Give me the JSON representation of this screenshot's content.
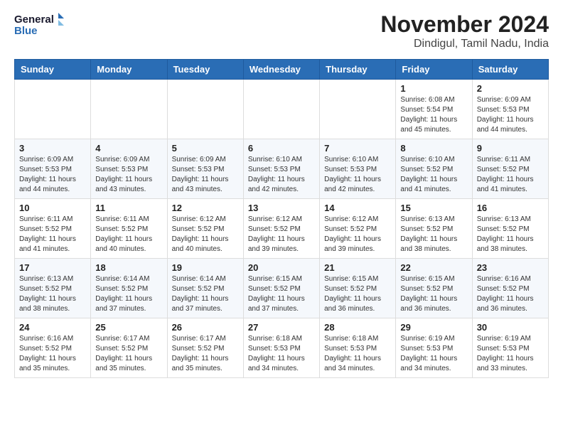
{
  "logo": {
    "line1": "General",
    "line2": "Blue"
  },
  "title": "November 2024",
  "subtitle": "Dindigul, Tamil Nadu, India",
  "weekdays": [
    "Sunday",
    "Monday",
    "Tuesday",
    "Wednesday",
    "Thursday",
    "Friday",
    "Saturday"
  ],
  "weeks": [
    [
      {
        "day": "",
        "sunrise": "",
        "sunset": "",
        "daylight": ""
      },
      {
        "day": "",
        "sunrise": "",
        "sunset": "",
        "daylight": ""
      },
      {
        "day": "",
        "sunrise": "",
        "sunset": "",
        "daylight": ""
      },
      {
        "day": "",
        "sunrise": "",
        "sunset": "",
        "daylight": ""
      },
      {
        "day": "",
        "sunrise": "",
        "sunset": "",
        "daylight": ""
      },
      {
        "day": "1",
        "sunrise": "Sunrise: 6:08 AM",
        "sunset": "Sunset: 5:54 PM",
        "daylight": "Daylight: 11 hours and 45 minutes."
      },
      {
        "day": "2",
        "sunrise": "Sunrise: 6:09 AM",
        "sunset": "Sunset: 5:53 PM",
        "daylight": "Daylight: 11 hours and 44 minutes."
      }
    ],
    [
      {
        "day": "3",
        "sunrise": "Sunrise: 6:09 AM",
        "sunset": "Sunset: 5:53 PM",
        "daylight": "Daylight: 11 hours and 44 minutes."
      },
      {
        "day": "4",
        "sunrise": "Sunrise: 6:09 AM",
        "sunset": "Sunset: 5:53 PM",
        "daylight": "Daylight: 11 hours and 43 minutes."
      },
      {
        "day": "5",
        "sunrise": "Sunrise: 6:09 AM",
        "sunset": "Sunset: 5:53 PM",
        "daylight": "Daylight: 11 hours and 43 minutes."
      },
      {
        "day": "6",
        "sunrise": "Sunrise: 6:10 AM",
        "sunset": "Sunset: 5:53 PM",
        "daylight": "Daylight: 11 hours and 42 minutes."
      },
      {
        "day": "7",
        "sunrise": "Sunrise: 6:10 AM",
        "sunset": "Sunset: 5:53 PM",
        "daylight": "Daylight: 11 hours and 42 minutes."
      },
      {
        "day": "8",
        "sunrise": "Sunrise: 6:10 AM",
        "sunset": "Sunset: 5:52 PM",
        "daylight": "Daylight: 11 hours and 41 minutes."
      },
      {
        "day": "9",
        "sunrise": "Sunrise: 6:11 AM",
        "sunset": "Sunset: 5:52 PM",
        "daylight": "Daylight: 11 hours and 41 minutes."
      }
    ],
    [
      {
        "day": "10",
        "sunrise": "Sunrise: 6:11 AM",
        "sunset": "Sunset: 5:52 PM",
        "daylight": "Daylight: 11 hours and 41 minutes."
      },
      {
        "day": "11",
        "sunrise": "Sunrise: 6:11 AM",
        "sunset": "Sunset: 5:52 PM",
        "daylight": "Daylight: 11 hours and 40 minutes."
      },
      {
        "day": "12",
        "sunrise": "Sunrise: 6:12 AM",
        "sunset": "Sunset: 5:52 PM",
        "daylight": "Daylight: 11 hours and 40 minutes."
      },
      {
        "day": "13",
        "sunrise": "Sunrise: 6:12 AM",
        "sunset": "Sunset: 5:52 PM",
        "daylight": "Daylight: 11 hours and 39 minutes."
      },
      {
        "day": "14",
        "sunrise": "Sunrise: 6:12 AM",
        "sunset": "Sunset: 5:52 PM",
        "daylight": "Daylight: 11 hours and 39 minutes."
      },
      {
        "day": "15",
        "sunrise": "Sunrise: 6:13 AM",
        "sunset": "Sunset: 5:52 PM",
        "daylight": "Daylight: 11 hours and 38 minutes."
      },
      {
        "day": "16",
        "sunrise": "Sunrise: 6:13 AM",
        "sunset": "Sunset: 5:52 PM",
        "daylight": "Daylight: 11 hours and 38 minutes."
      }
    ],
    [
      {
        "day": "17",
        "sunrise": "Sunrise: 6:13 AM",
        "sunset": "Sunset: 5:52 PM",
        "daylight": "Daylight: 11 hours and 38 minutes."
      },
      {
        "day": "18",
        "sunrise": "Sunrise: 6:14 AM",
        "sunset": "Sunset: 5:52 PM",
        "daylight": "Daylight: 11 hours and 37 minutes."
      },
      {
        "day": "19",
        "sunrise": "Sunrise: 6:14 AM",
        "sunset": "Sunset: 5:52 PM",
        "daylight": "Daylight: 11 hours and 37 minutes."
      },
      {
        "day": "20",
        "sunrise": "Sunrise: 6:15 AM",
        "sunset": "Sunset: 5:52 PM",
        "daylight": "Daylight: 11 hours and 37 minutes."
      },
      {
        "day": "21",
        "sunrise": "Sunrise: 6:15 AM",
        "sunset": "Sunset: 5:52 PM",
        "daylight": "Daylight: 11 hours and 36 minutes."
      },
      {
        "day": "22",
        "sunrise": "Sunrise: 6:15 AM",
        "sunset": "Sunset: 5:52 PM",
        "daylight": "Daylight: 11 hours and 36 minutes."
      },
      {
        "day": "23",
        "sunrise": "Sunrise: 6:16 AM",
        "sunset": "Sunset: 5:52 PM",
        "daylight": "Daylight: 11 hours and 36 minutes."
      }
    ],
    [
      {
        "day": "24",
        "sunrise": "Sunrise: 6:16 AM",
        "sunset": "Sunset: 5:52 PM",
        "daylight": "Daylight: 11 hours and 35 minutes."
      },
      {
        "day": "25",
        "sunrise": "Sunrise: 6:17 AM",
        "sunset": "Sunset: 5:52 PM",
        "daylight": "Daylight: 11 hours and 35 minutes."
      },
      {
        "day": "26",
        "sunrise": "Sunrise: 6:17 AM",
        "sunset": "Sunset: 5:52 PM",
        "daylight": "Daylight: 11 hours and 35 minutes."
      },
      {
        "day": "27",
        "sunrise": "Sunrise: 6:18 AM",
        "sunset": "Sunset: 5:53 PM",
        "daylight": "Daylight: 11 hours and 34 minutes."
      },
      {
        "day": "28",
        "sunrise": "Sunrise: 6:18 AM",
        "sunset": "Sunset: 5:53 PM",
        "daylight": "Daylight: 11 hours and 34 minutes."
      },
      {
        "day": "29",
        "sunrise": "Sunrise: 6:19 AM",
        "sunset": "Sunset: 5:53 PM",
        "daylight": "Daylight: 11 hours and 34 minutes."
      },
      {
        "day": "30",
        "sunrise": "Sunrise: 6:19 AM",
        "sunset": "Sunset: 5:53 PM",
        "daylight": "Daylight: 11 hours and 33 minutes."
      }
    ]
  ]
}
